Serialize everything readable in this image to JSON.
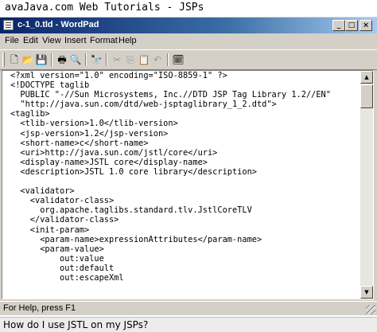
{
  "page_header": {
    "text": "avaJava.com Web Tutorials - JSPs"
  },
  "window": {
    "title": "c-1_0.tld - WordPad",
    "controls": {
      "minimize": "_",
      "maximize": "□",
      "close": "×"
    }
  },
  "menu": {
    "items": [
      "File",
      "Edit",
      "View",
      "Insert",
      "Format",
      "Help"
    ]
  },
  "toolbar": {
    "icons": [
      {
        "name": "new-icon",
        "glyph": "🗋",
        "enabled": true
      },
      {
        "name": "open-icon",
        "glyph": "📂",
        "enabled": true
      },
      {
        "name": "save-icon",
        "glyph": "💾",
        "enabled": true
      },
      {
        "name": "print-icon",
        "glyph": "🖶",
        "enabled": true
      },
      {
        "name": "print-preview-icon",
        "glyph": "🔍",
        "enabled": true
      },
      {
        "name": "find-icon",
        "glyph": "🔭",
        "enabled": true
      },
      {
        "name": "cut-icon",
        "glyph": "✂",
        "enabled": false
      },
      {
        "name": "copy-icon",
        "glyph": "⎘",
        "enabled": false
      },
      {
        "name": "paste-icon",
        "glyph": "📋",
        "enabled": true
      },
      {
        "name": "undo-icon",
        "glyph": "↶",
        "enabled": false
      },
      {
        "name": "insert-date-time-icon",
        "glyph": "🗓",
        "enabled": true
      }
    ]
  },
  "document": {
    "lines": [
      "<?xml version=\"1.0\" encoding=\"ISO-8859-1\" ?>",
      "<!DOCTYPE taglib",
      "  PUBLIC \"-//Sun Microsystems, Inc.//DTD JSP Tag Library 1.2//EN\"",
      "  \"http://java.sun.com/dtd/web-jsptaglibrary_1_2.dtd\">",
      "<taglib>",
      "  <tlib-version>1.0</tlib-version>",
      "  <jsp-version>1.2</jsp-version>",
      "  <short-name>c</short-name>",
      "  <uri>http://java.sun.com/jstl/core</uri>",
      "  <display-name>JSTL core</display-name>",
      "  <description>JSTL 1.0 core library</description>",
      "",
      "  <validator>",
      "    <validator-class>",
      "      org.apache.taglibs.standard.tlv.JstlCoreTLV",
      "    </validator-class>",
      "    <init-param>",
      "      <param-name>expressionAttributes</param-name>",
      "      <param-value>",
      "          out:value",
      "          out:default",
      "          out:escapeXml"
    ]
  },
  "statusbar": {
    "text": "For Help, press F1"
  },
  "caption": {
    "text": "How do I use JSTL on my JSPs?"
  }
}
